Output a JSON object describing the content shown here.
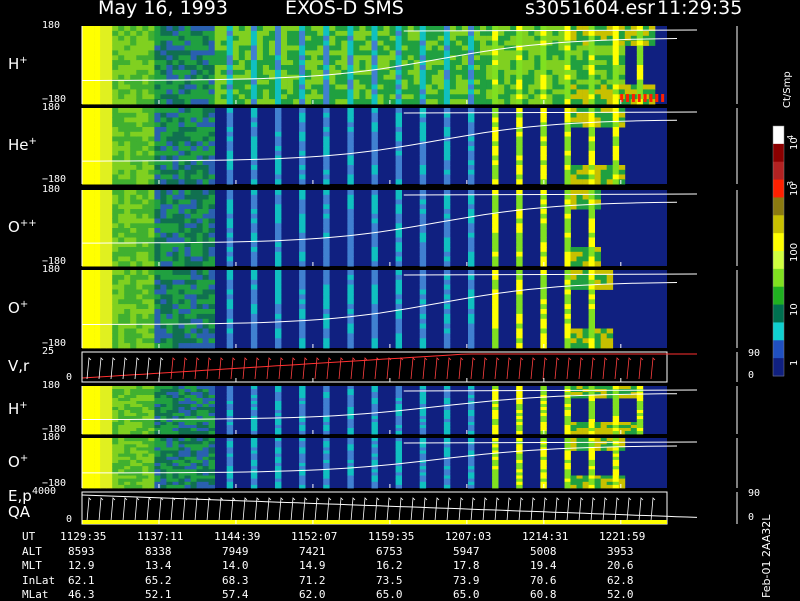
{
  "header": {
    "date": "May 16, 1993",
    "instrument": "EXOS-D SMS",
    "file": "s3051604.esr",
    "time": "11:29:35"
  },
  "colorbar": {
    "unit": "Ct/Smp",
    "labels": [
      "10",
      "4",
      "10",
      "3",
      "100",
      "10",
      "1"
    ],
    "colors": [
      "#ffffff",
      "#8b0000",
      "#b22222",
      "#ff2000",
      "#8a7a10",
      "#c8c000",
      "#ffff00",
      "#d0ff40",
      "#80e020",
      "#20b020",
      "#007050",
      "#10d0d0",
      "#2050c0",
      "#102080"
    ]
  },
  "panels": [
    {
      "label": "H",
      "charge": "+",
      "ytop": "180",
      "ybot": "−180",
      "active_end": 0.97
    },
    {
      "label": "He",
      "charge": "+",
      "ytop": "180",
      "ybot": "−180",
      "active_end": 0.92
    },
    {
      "label": "O",
      "charge": "++",
      "ytop": "180",
      "ybot": "−180",
      "active_end": 0.88
    },
    {
      "label": "O",
      "charge": "+",
      "ytop": "180",
      "ybot": "−180",
      "active_end": 0.9
    },
    {
      "label": "V,r",
      "charge": "",
      "ytop": "25",
      "ybot": "0",
      "right_top": "90",
      "right_bot": "0"
    },
    {
      "label": "H",
      "charge": "+",
      "ytop": "180",
      "ybot": "−180",
      "active_end": 0.95
    },
    {
      "label": "O",
      "charge": "+",
      "ytop": "180",
      "ybot": "−180",
      "active_end": 0.92
    },
    {
      "label": "E,p",
      "label2": "QA",
      "charge": "",
      "ytop": "4000",
      "ybot": "0",
      "right_top": "90",
      "right_bot": "0"
    }
  ],
  "table": {
    "rows": [
      {
        "name": "UT",
        "values": [
          "1129:35",
          "1137:11",
          "1144:39",
          "1152:07",
          "1159:35",
          "1207:03",
          "1214:31",
          "1221:59"
        ]
      },
      {
        "name": "ALT",
        "values": [
          "8593",
          "8338",
          "7949",
          "7421",
          "6753",
          "5947",
          "5008",
          "3953"
        ]
      },
      {
        "name": "MLT",
        "values": [
          "12.9",
          "13.4",
          "14.0",
          "14.9",
          "16.2",
          "17.8",
          "19.4",
          "20.6"
        ]
      },
      {
        "name": "InLat",
        "values": [
          "62.1",
          "65.2",
          "68.3",
          "71.2",
          "73.5",
          "73.9",
          "70.6",
          "62.8"
        ]
      },
      {
        "name": "MLat",
        "values": [
          "46.3",
          "52.1",
          "57.4",
          "62.0",
          "65.0",
          "65.0",
          "60.8",
          "52.0"
        ]
      }
    ]
  },
  "footer": {
    "stamp": "Feb-01 2AA32L"
  },
  "chart_data": {
    "type": "heatmap",
    "x": [
      "1129:35",
      "1137:11",
      "1144:39",
      "1152:07",
      "1159:35",
      "1207:03",
      "1214:31",
      "1221:59"
    ],
    "xlabel": "UT",
    "series": [
      {
        "name": "H+",
        "ylim": [
          -180,
          180
        ]
      },
      {
        "name": "He+",
        "ylim": [
          -180,
          180
        ]
      },
      {
        "name": "O++",
        "ylim": [
          -180,
          180
        ]
      },
      {
        "name": "O+",
        "ylim": [
          -180,
          180
        ]
      },
      {
        "name": "V,r",
        "ylim": [
          0,
          25
        ]
      },
      {
        "name": "H+",
        "ylim": [
          -180,
          180
        ]
      },
      {
        "name": "O+",
        "ylim": [
          -180,
          180
        ]
      },
      {
        "name": "E,p",
        "ylim": [
          0,
          4000
        ]
      }
    ],
    "colorscale": {
      "label": "Ct/Smp",
      "range": [
        1,
        10000
      ],
      "scale": "log"
    }
  }
}
